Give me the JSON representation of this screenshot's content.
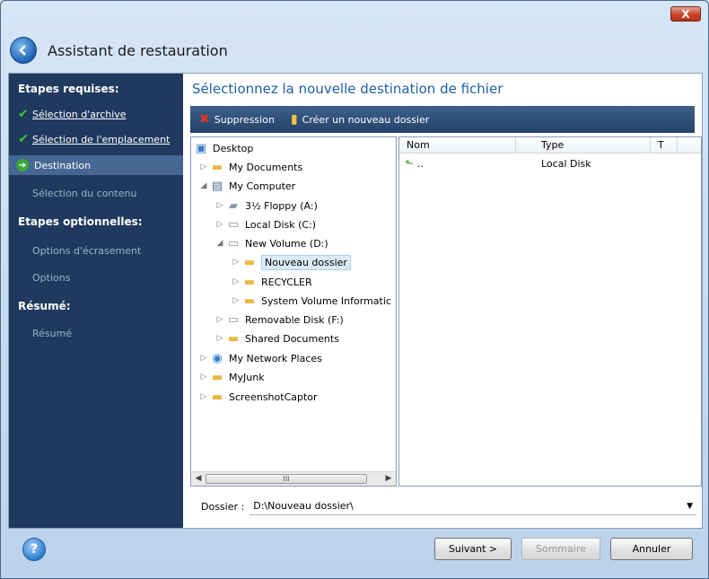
{
  "window": {
    "title": "Assistant de restauration",
    "close_label": "X"
  },
  "sidebar": {
    "required_heading": "Etapes requises:",
    "required_items": [
      {
        "label": "Sélection d'archive",
        "state": "done"
      },
      {
        "label": "Sélection de l'emplacement",
        "state": "done"
      },
      {
        "label": "Destination",
        "state": "current"
      },
      {
        "label": "Sélection du contenu",
        "state": "pending"
      }
    ],
    "optional_heading": "Etapes optionnelles:",
    "optional_items": [
      {
        "label": "Options d'écrasement"
      },
      {
        "label": "Options"
      }
    ],
    "summary_heading": "Résumé:",
    "summary_items": [
      {
        "label": "Résumé"
      }
    ]
  },
  "main": {
    "heading": "Sélectionnez la nouvelle destination de fichier",
    "toolbar": {
      "delete_label": "Suppression",
      "new_folder_label": "Créer un nouveau dossier"
    },
    "tree": [
      {
        "label": "Desktop",
        "icon": "desktop-icon",
        "level": 0
      },
      {
        "label": "My Documents",
        "icon": "folder-icon",
        "level": 1
      },
      {
        "label": "My Computer",
        "icon": "computer-icon",
        "level": 1
      },
      {
        "label": "3½ Floppy (A:)",
        "icon": "floppy-icon",
        "level": 2
      },
      {
        "label": "Local Disk (C:)",
        "icon": "drive-icon",
        "level": 2
      },
      {
        "label": "New Volume (D:)",
        "icon": "drive-icon",
        "level": 2
      },
      {
        "label": "Nouveau dossier",
        "icon": "folder-icon",
        "level": 3,
        "selected": true
      },
      {
        "label": "RECYCLER",
        "icon": "folder-icon",
        "level": 3
      },
      {
        "label": "System Volume Informatic",
        "icon": "folder-icon",
        "level": 3
      },
      {
        "label": "Removable Disk (F:)",
        "icon": "drive-icon",
        "level": 2
      },
      {
        "label": "Shared Documents",
        "icon": "folder-icon",
        "level": 2
      },
      {
        "label": "My Network Places",
        "icon": "network-icon",
        "level": 1
      },
      {
        "label": "MyJunk",
        "icon": "folder-icon",
        "level": 1
      },
      {
        "label": "ScreenshotCaptor",
        "icon": "folder-icon",
        "level": 1
      }
    ],
    "scroll_thumb_label": "III",
    "list": {
      "columns": [
        "Nom",
        "Type",
        "T"
      ],
      "rows": [
        {
          "name": "..",
          "type": "Local Disk"
        }
      ]
    },
    "folder_label": "Dossier :",
    "folder_value": "D:\\Nouveau dossier\\"
  },
  "buttons": {
    "help": "?",
    "next": "Suivant >",
    "summary": "Sommaire",
    "cancel": "Annuler"
  }
}
